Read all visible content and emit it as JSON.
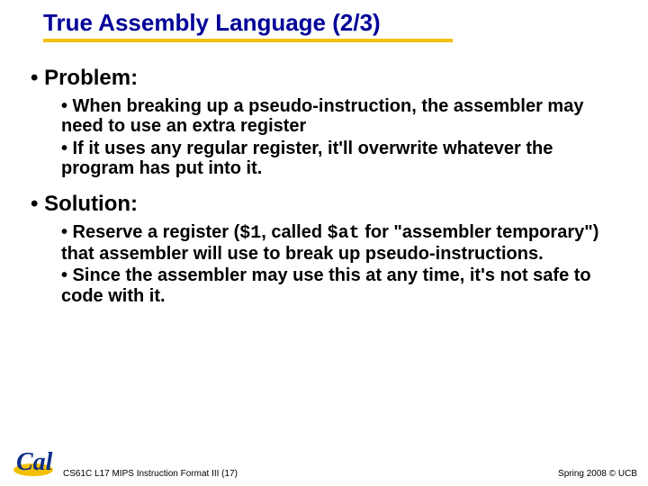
{
  "title": "True Assembly Language (2/3)",
  "sections": {
    "problem": {
      "heading": "• Problem:",
      "bullets": [
        "• When breaking up a pseudo-instruction, the assembler may need to use an extra register",
        "• If it uses any regular register, it'll overwrite whatever the program has put into it."
      ]
    },
    "solution": {
      "heading": "• Solution:",
      "bullet1_pre": "• Reserve a register (",
      "bullet1_code1": "$1",
      "bullet1_mid": ", called ",
      "bullet1_code2": "$at",
      "bullet1_post": " for \"assembler temporary\") that assembler will use to break up pseudo-instructions.",
      "bullet2": "• Since the assembler may use this at any time, it's not safe to code with it."
    }
  },
  "footer": {
    "left": "CS61C L17 MIPS Instruction Format III (17)",
    "right": "Spring 2008 © UCB",
    "logo_text": "Cal"
  }
}
